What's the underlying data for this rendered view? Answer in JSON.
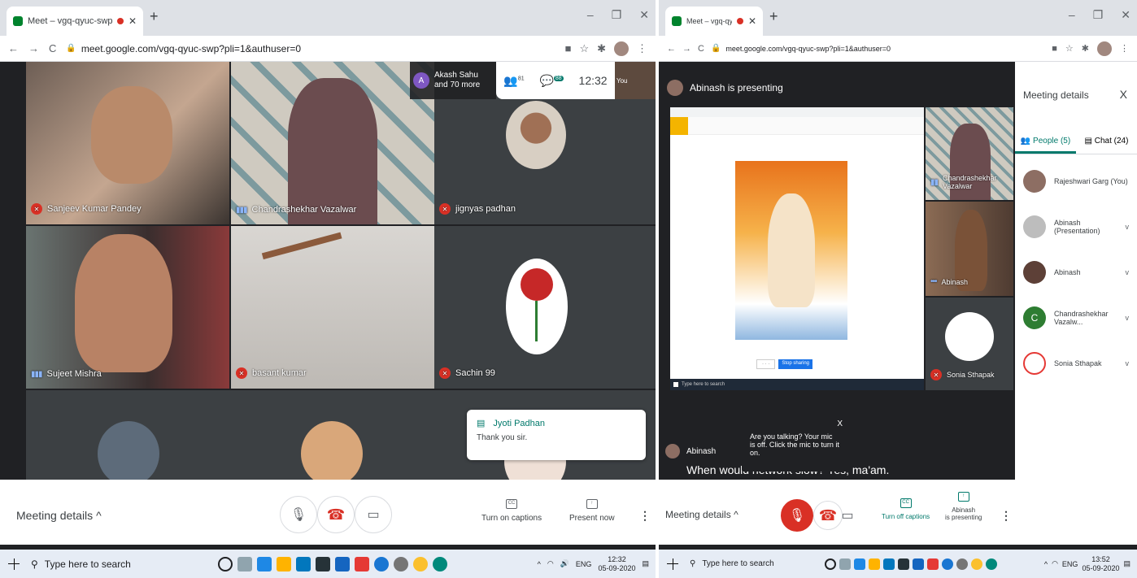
{
  "left": {
    "tab_title": "Meet – vgq-qyuc-swp",
    "url": "meet.google.com/vgq-qyuc-swp?pli=1&authuser=0",
    "topbar": {
      "host_initial": "A",
      "host_name": "Akash Sahu",
      "host_more": "and 70 more",
      "people_count": "81",
      "chat_count": "88",
      "time": "12:32",
      "self_label": "You"
    },
    "tiles": [
      {
        "name": "Sanjeev Kumar Pandey",
        "muted": true
      },
      {
        "name": "Chandrashekhar Vazalwar",
        "muted": false
      },
      {
        "name": "jignyas padhan",
        "muted": true
      },
      {
        "name": "Sujeet Mishra",
        "muted": false
      },
      {
        "name": "basant kumar",
        "muted": true
      },
      {
        "name": "Sachin 99",
        "muted": true
      }
    ],
    "chat_toast": {
      "name": "Jyoti Padhan",
      "message": "Thank you sir."
    },
    "controls": {
      "meeting_details": "Meeting details",
      "captions": "Turn on captions",
      "present": "Present now"
    },
    "taskbar": {
      "search": "Type here to search",
      "lang": "ENG",
      "time": "12:32",
      "date": "05-09-2020"
    }
  },
  "right": {
    "tab_title": "Meet – vgq-qyuc-swp",
    "url": "meet.google.com/vgq-qyuc-swp?pli=1&authuser=0",
    "presenting_label": "Abinash is presenting",
    "tiles": [
      {
        "name": "Chandrashekhar Vazalwar"
      },
      {
        "name": "Abinash"
      },
      {
        "name": "Sonia Sthapak"
      }
    ],
    "presentation": {
      "button": "Stop sharing",
      "search": "Type here to search"
    },
    "caption": {
      "speaker": "Abinash",
      "text": "When would network slow? Yes, ma'am."
    },
    "mic_tooltip": {
      "text": "Are you talking? Your mic is off. Click the mic to turn it on.",
      "close": "X"
    },
    "side": {
      "title": "Meeting details",
      "close": "X",
      "people_tab": "People (5)",
      "chat_tab": "Chat (24)",
      "people": [
        {
          "name": "Rajeshwari Garg (You)"
        },
        {
          "name": "Abinash (Presentation)"
        },
        {
          "name": "Abinash"
        },
        {
          "name": "Chandrashekhar Vazalw..."
        },
        {
          "name": "Sonia Sthapak"
        }
      ],
      "people_initial_c": "C"
    },
    "controls": {
      "meeting_details": "Meeting details",
      "captions": "Turn off captions",
      "present_line1": "Abinash",
      "present_line2": "is presenting"
    },
    "taskbar": {
      "search": "Type here to search",
      "lang": "ENG",
      "time": "13:52",
      "date": "05-09-2020"
    }
  },
  "colors": {
    "meet_green": "#00796b",
    "mute_red": "#d93025",
    "bg_dark": "#202124"
  }
}
